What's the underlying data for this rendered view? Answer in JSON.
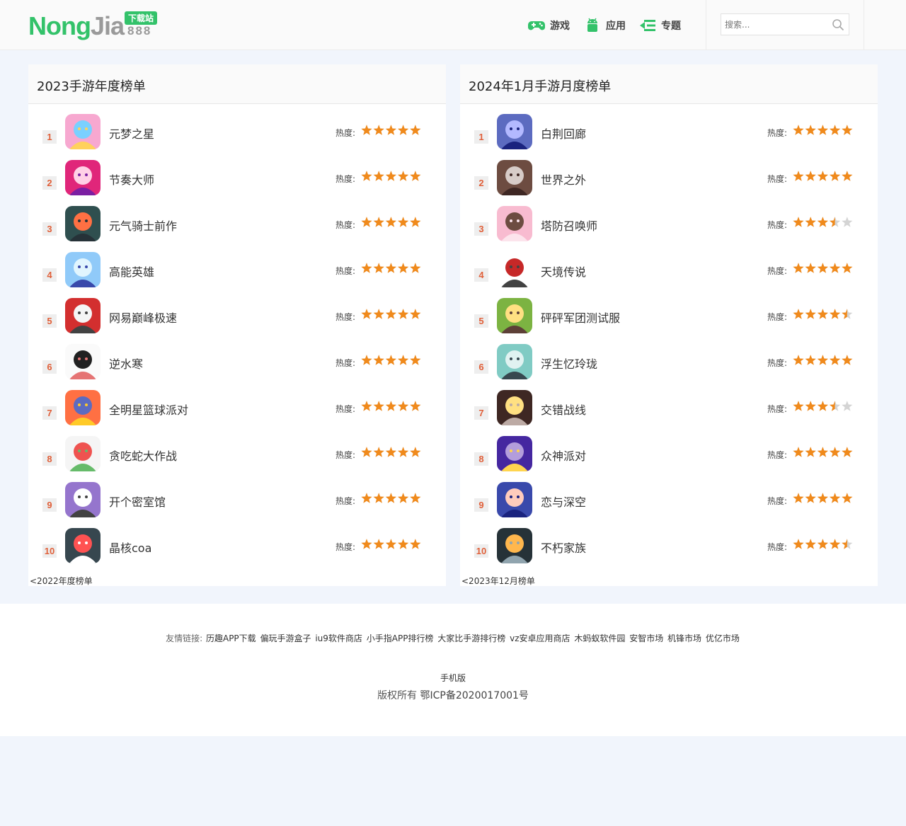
{
  "header": {
    "logo_text_a": "Nong",
    "logo_text_b": "Jia",
    "logo_badge": "下载站",
    "logo_num": "888",
    "nav": [
      {
        "label": "游戏",
        "icon": "gamepad-icon"
      },
      {
        "label": "应用",
        "icon": "android-icon"
      },
      {
        "label": "专题",
        "icon": "topic-icon"
      }
    ],
    "search_placeholder": "搜索...",
    "accent_color": "#33c26a"
  },
  "panels": [
    {
      "title": "2023手游年度榜单",
      "more_link": "<2022年度榜单",
      "hot_label": "热度:",
      "items": [
        {
          "rank": "1",
          "name": "元梦之星",
          "rating": 5
        },
        {
          "rank": "2",
          "name": "节奏大师",
          "rating": 5
        },
        {
          "rank": "3",
          "name": "元气骑士前作",
          "rating": 5
        },
        {
          "rank": "4",
          "name": "高能英雄",
          "rating": 5
        },
        {
          "rank": "5",
          "name": "网易巅峰极速",
          "rating": 5
        },
        {
          "rank": "6",
          "name": "逆水寒",
          "rating": 5
        },
        {
          "rank": "7",
          "name": "全明星篮球派对",
          "rating": 5
        },
        {
          "rank": "8",
          "name": "贪吃蛇大作战",
          "rating": 5
        },
        {
          "rank": "9",
          "name": "开个密室馆",
          "rating": 5
        },
        {
          "rank": "10",
          "name": "晶核coa",
          "rating": 5
        }
      ]
    },
    {
      "title": "2024年1月手游月度榜单",
      "more_link": "<2023年12月榜单",
      "hot_label": "热度:",
      "items": [
        {
          "rank": "1",
          "name": "白荆回廊",
          "rating": 5
        },
        {
          "rank": "2",
          "name": "世界之外",
          "rating": 5
        },
        {
          "rank": "3",
          "name": "塔防召唤师",
          "rating": 3.5
        },
        {
          "rank": "4",
          "name": "天境传说",
          "rating": 5
        },
        {
          "rank": "5",
          "name": "砰砰军团测试服",
          "rating": 4.5
        },
        {
          "rank": "6",
          "name": "浮生忆玲珑",
          "rating": 5
        },
        {
          "rank": "7",
          "name": "交错战线",
          "rating": 3.5
        },
        {
          "rank": "8",
          "name": "众神派对",
          "rating": 5
        },
        {
          "rank": "9",
          "name": "恋与深空",
          "rating": 5
        },
        {
          "rank": "10",
          "name": "不朽家族",
          "rating": 4.5
        }
      ]
    }
  ],
  "star_color": "#f08a1c",
  "star_empty_color": "#d4d4d4",
  "footer": {
    "friends_label": "友情链接:",
    "friends": [
      "历趣APP下载",
      "偏玩手游盒子",
      "iu9软件商店",
      "小手指APP排行榜",
      "大家比手游排行榜",
      "vz安卓应用商店",
      "木蚂蚁软件园",
      "安智市场",
      "机锋市场",
      "优亿市场"
    ],
    "mobile": "手机版",
    "copyright": "版权所有",
    "icp": "鄂ICP备2020017001号"
  }
}
